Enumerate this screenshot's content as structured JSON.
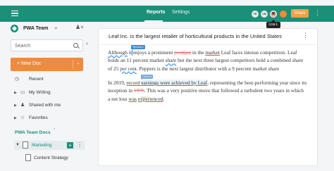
{
  "topbar": {
    "tabs": [
      {
        "label": "Reports",
        "active": true
      },
      {
        "label": "Settings",
        "active": false
      }
    ],
    "avatars": [
      "TE",
      "CB"
    ],
    "share_label": "Share",
    "tooltip": "Lisa L"
  },
  "sidebar": {
    "team_name": "PWA Team",
    "search_placeholder": "Search",
    "new_doc_label": "+ New Doc",
    "items": [
      {
        "label": "Recent",
        "icon": "clock-icon"
      },
      {
        "label": "My Writing",
        "icon": "folder-icon"
      },
      {
        "label": "Shared with me",
        "icon": "users-icon"
      },
      {
        "label": "Favorites",
        "icon": "star-icon"
      }
    ],
    "section_title": "PWA Team Docs",
    "tree": {
      "folder": "Marketing",
      "child": "Content Strategy"
    }
  },
  "document": {
    "title": "Leaf Inc. is the largest retailer of horticultural products in the United States",
    "paragraph1": [
      [
        "Although",
        " it enjoys a prominent ",
        "position",
        " in the ",
        "market",
        " Leaf faces intense competition. Leaf"
      ],
      [
        "holds an 11 percent market ",
        "share",
        " but the next three largest competitors hold a combined share"
      ],
      [
        "of 25 ",
        "per cent",
        ". Peppers is the next largest distributor with a 9 percent market share"
      ]
    ],
    "paragraph2": [
      [
        "In 2019, ",
        "record ",
        "earnings were achieved by Leaf",
        ", representing the best-performing year since its"
      ],
      [
        "inception in ",
        "1976",
        ". This was a very positive move that followed a turbulent two years in which"
      ],
      [
        "a net loss ",
        "was",
        " ",
        "experienced",
        "."
      ]
    ],
    "collaborators": [
      {
        "name": "Teresa K",
        "color": "#3a8fd9"
      },
      {
        "name": "Chris B",
        "color": "#7aa6d6"
      }
    ],
    "ghost_labels": [
      "Lisa L",
      "Lisa L"
    ]
  },
  "colors": {
    "brand": "#1b8f78",
    "accent": "#f08a3c",
    "share": "#f4a04a"
  }
}
